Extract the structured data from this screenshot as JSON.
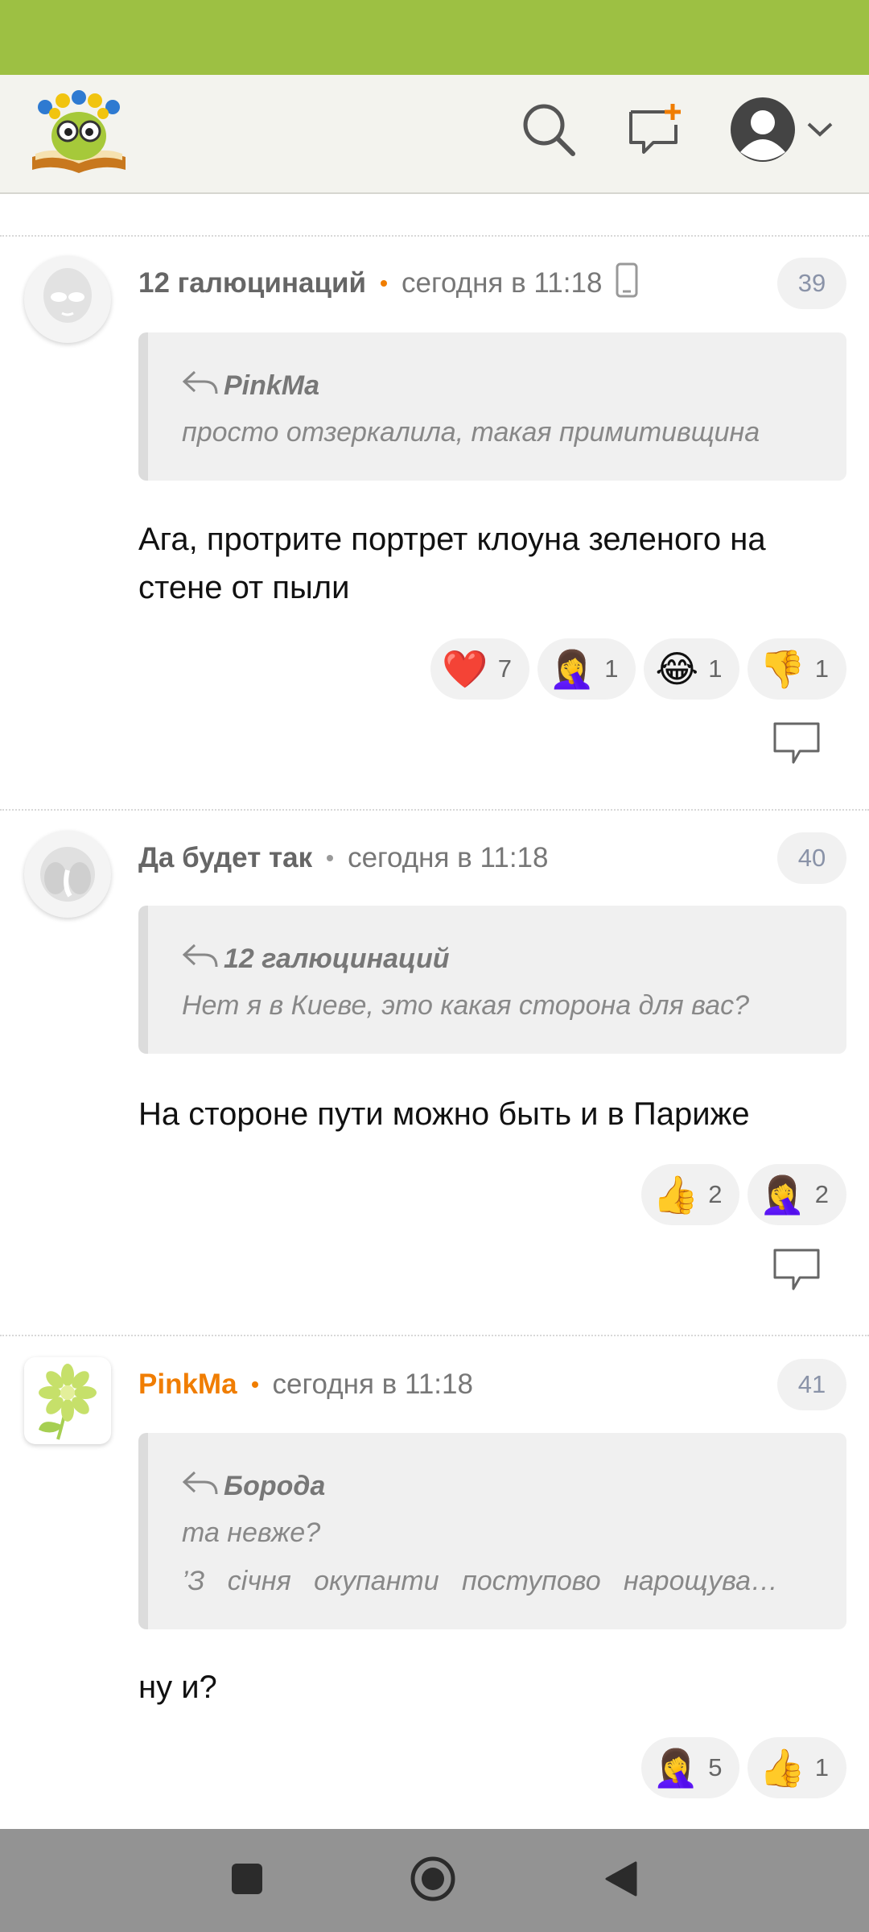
{
  "header": {
    "logo": "site-logo-book-with-glasses",
    "icons": [
      "search-icon",
      "new-post-icon",
      "profile-icon",
      "chevron-down-icon"
    ]
  },
  "comments": [
    {
      "author": "12 галюцинаций",
      "time": "сегодня в 11:18",
      "number": "39",
      "device_icon": "mobile-phone-icon",
      "quote": {
        "author": "PinkMa",
        "lines": [
          "просто отзеркалила, такая примитивщина"
        ]
      },
      "text": "Ага, протрите портрет клоуна зеленого на стене от пыли",
      "reactions": [
        {
          "emoji": "❤️",
          "count": "7",
          "icon": "heart-icon"
        },
        {
          "emoji": "🤦‍♀️",
          "count": "1",
          "icon": "facepalm-icon"
        },
        {
          "emoji": "😂",
          "count": "1",
          "icon": "laughing-icon"
        },
        {
          "emoji": "👎",
          "count": "1",
          "icon": "thumbs-down-icon"
        }
      ]
    },
    {
      "author": "Да будет так",
      "time": "сегодня в 11:18",
      "number": "40",
      "quote": {
        "author": "12 галюцинаций",
        "lines": [
          "Нет я в Киеве, это какая сторона для вас?"
        ]
      },
      "text": "На стороне пути можно быть и в Париже",
      "reactions": [
        {
          "emoji": "👍",
          "count": "2",
          "icon": "thumbs-up-icon"
        },
        {
          "emoji": "🤦‍♀️",
          "count": "2",
          "icon": "facepalm-icon"
        }
      ]
    },
    {
      "author": "PinkMa",
      "time": "сегодня в 11:18",
      "number": "41",
      "quote": {
        "author": "Борода",
        "lines": [
          "та невже?",
          "’З   січня   окупанти   поступово   нарощува…"
        ]
      },
      "text": "ну и?",
      "reactions": [
        {
          "emoji": "🤦‍♀️",
          "count": "5",
          "icon": "facepalm-icon"
        },
        {
          "emoji": "👍",
          "count": "1",
          "icon": "thumbs-up-icon"
        }
      ]
    }
  ],
  "nav": {
    "icons": [
      "recent-apps-icon",
      "home-icon",
      "back-icon"
    ]
  },
  "colors": {
    "status_bar": "#9dc043",
    "accent_orange": "#f07d00",
    "header_bg": "#f3f3ee"
  }
}
